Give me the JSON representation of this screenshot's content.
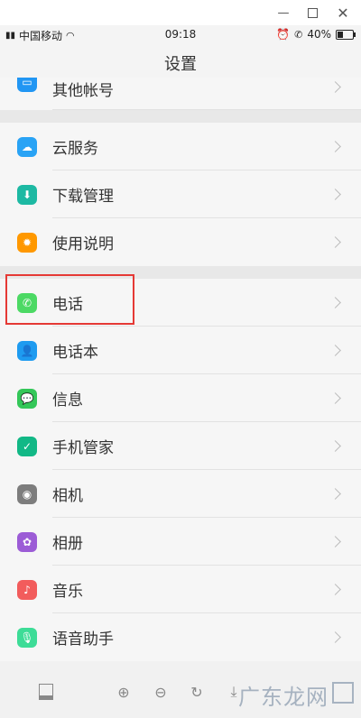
{
  "window": {
    "minimize_icon": "minimize-icon",
    "maximize_icon": "maximize-icon",
    "close_icon": "close-icon"
  },
  "status_bar": {
    "carrier": "中国移动",
    "time": "09:18",
    "battery": "40%",
    "battery_level": 0.4
  },
  "header": {
    "title": "设置"
  },
  "items": [
    {
      "label": "其他帐号",
      "icon": "account-icon",
      "color": "#2196F3"
    },
    {
      "label": "云服务",
      "icon": "cloud-icon",
      "color": "#29A3F5"
    },
    {
      "label": "下载管理",
      "icon": "download-icon",
      "color": "#1DB9A3"
    },
    {
      "label": "使用说明",
      "icon": "bulb-icon",
      "color": "#FF9800"
    },
    {
      "label": "电话",
      "icon": "phone-icon",
      "color": "#4CD964"
    },
    {
      "label": "电话本",
      "icon": "contacts-icon",
      "color": "#1E9BF0"
    },
    {
      "label": "信息",
      "icon": "message-icon",
      "color": "#34C759"
    },
    {
      "label": "手机管家",
      "icon": "shield-icon",
      "color": "#12B886"
    },
    {
      "label": "相机",
      "icon": "camera-icon",
      "color": "#7D7D7D"
    },
    {
      "label": "相册",
      "icon": "gallery-icon",
      "color": "#9C5CD6"
    },
    {
      "label": "音乐",
      "icon": "music-icon",
      "color": "#F25C5C"
    },
    {
      "label": "语音助手",
      "icon": "mic-icon",
      "color": "#3DDC97"
    }
  ],
  "watermark": {
    "text": "广东龙网"
  }
}
